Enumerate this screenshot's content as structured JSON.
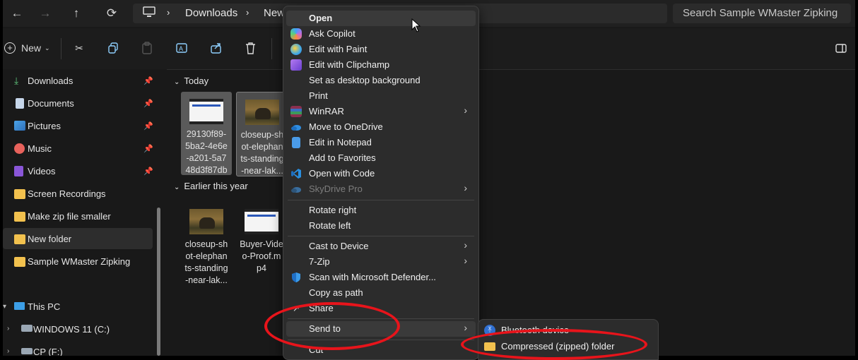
{
  "nav": {
    "breadcrumb": [
      "Downloads",
      "New"
    ],
    "search_placeholder": "Search Sample WMaster Zipking"
  },
  "toolbar": {
    "new_label": "New"
  },
  "sidebar": {
    "quick": [
      {
        "label": "Downloads",
        "icon": "download-icon"
      },
      {
        "label": "Documents",
        "icon": "documents-icon"
      },
      {
        "label": "Pictures",
        "icon": "pictures-icon"
      },
      {
        "label": "Music",
        "icon": "music-icon"
      },
      {
        "label": "Videos",
        "icon": "videos-icon"
      }
    ],
    "folders": [
      "Screen Recordings",
      "Make zip file smaller",
      "New folder",
      "Sample WMaster Zipking"
    ],
    "this_pc": "This PC",
    "drive_c": "WINDOWS 11 (C:)",
    "drive_f": "CP (F:)"
  },
  "content": {
    "group_today": "Today",
    "group_earlier": "Earlier this year",
    "today_files": [
      {
        "name": "29130f89-5ba2-4e6e-a201-5a748d3f87db",
        "name_display": "29130f89-\n5ba2-4e6e\n-a201-5a7\n48d3f87db",
        "type": "video"
      },
      {
        "name": "closeup-shot-elephants-standing-near-lak...",
        "name_display": "closeup-sh\not-elephan\nts-standing\n-near-lak...",
        "type": "photo"
      }
    ],
    "earlier_files": [
      {
        "name": "closeup-shot-elephants-standing-near-lak...",
        "name_display": "closeup-sh\not-elephan\nts-standing\n-near-lak...",
        "type": "photo"
      },
      {
        "name": "Buyer-Video-Proof.mp4",
        "name_display": "Buyer-Vide\no-Proof.m\np4",
        "type": "video"
      }
    ]
  },
  "context_menu": {
    "items": [
      {
        "label": "Open",
        "bold": true
      },
      {
        "label": "Ask Copilot",
        "icon": "copilot-icon",
        "color": "#c46ad9"
      },
      {
        "label": "Edit with Paint",
        "icon": "paint-icon",
        "color": "#3fa9e6"
      },
      {
        "label": "Edit with Clipchamp",
        "icon": "clipchamp-icon",
        "color": "#8a4fd8"
      },
      {
        "label": "Set as desktop background"
      },
      {
        "label": "Print"
      },
      {
        "label": "WinRAR",
        "icon": "winrar-icon",
        "color": "#8b2f4f",
        "submenu": true
      },
      {
        "label": "Move to OneDrive",
        "icon": "onedrive-icon",
        "color": "#2f8de0"
      },
      {
        "label": "Edit in Notepad",
        "icon": "notepad-icon",
        "color": "#4a9be8"
      },
      {
        "label": "Add to Favorites"
      },
      {
        "label": "Open with Code",
        "icon": "vscode-icon",
        "color": "#2a8fe0"
      },
      {
        "label": "SkyDrive Pro",
        "icon": "skydrive-icon",
        "color": "#3a6e9e",
        "submenu": true,
        "disabled": true
      },
      {
        "label": "Rotate right"
      },
      {
        "label": "Rotate left"
      },
      {
        "label": "Cast to Device",
        "submenu": true
      },
      {
        "label": "7-Zip",
        "submenu": true
      },
      {
        "label": "Scan with Microsoft Defender...",
        "icon": "defender-icon",
        "color": "#1f6fc6"
      },
      {
        "label": "Copy as path"
      },
      {
        "label": "Share"
      },
      {
        "label": "Send to",
        "submenu": true
      },
      {
        "label": "Cut"
      }
    ]
  },
  "send_to_menu": {
    "items": [
      {
        "label": "Bluetooth device",
        "icon": "bluetooth-icon"
      },
      {
        "label": "Compressed (zipped) folder",
        "icon": "zip-folder-icon"
      }
    ]
  },
  "colors": {
    "annotation": "#e8141b",
    "folder": "#f2c14e"
  }
}
